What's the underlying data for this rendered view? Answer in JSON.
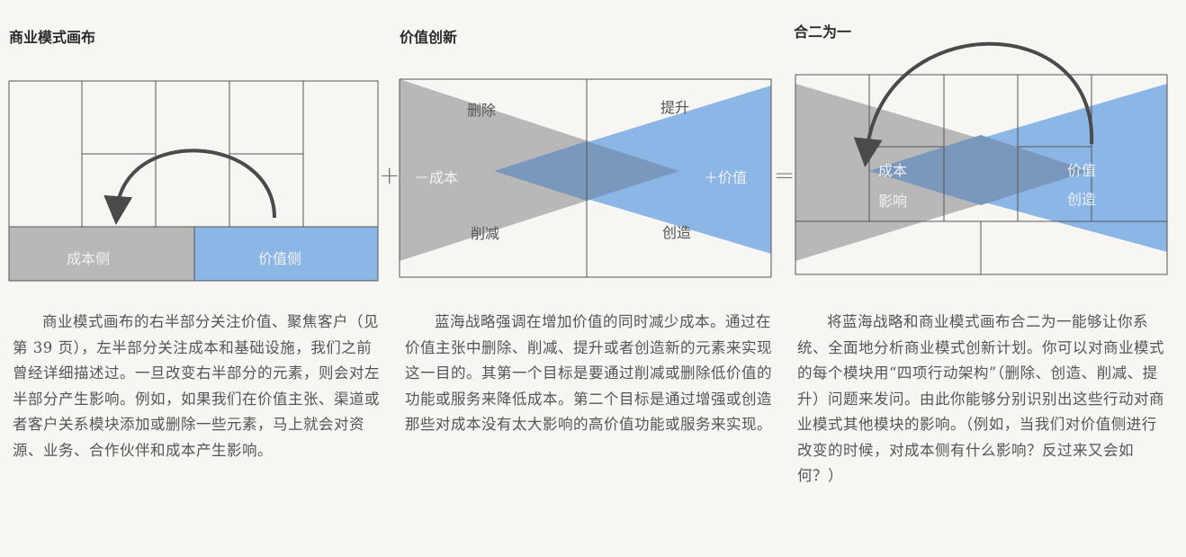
{
  "sections": [
    {
      "title": "商业模式画布",
      "labels": {
        "cost_side": "成本侧",
        "value_side": "价值侧"
      },
      "paragraph": "商业模式画布的右半部分关注价值、聚焦客户（见第 39 页），左半部分关注成本和基础设施，我们之前曾经详细描述过。一旦改变右半部分的元素，则会对左半部分产生影响。例如，如果我们在价值主张、渠道或者客户关系模块添加或删除一些元素，马上就会对资源、业务、合作伙伴和成本产生影响。"
    },
    {
      "title": "价值创新",
      "labels": {
        "eliminate": "删除",
        "raise": "提升",
        "cost": "－成本",
        "value": "＋价值",
        "reduce": "削减",
        "create": "创造"
      },
      "paragraph": "蓝海战略强调在增加价值的同时减少成本。通过在价值主张中删除、削减、提升或者创造新的元素来实现这一目的。其第一个目标是要通过削减或删除低价值的功能或服务来降低成本。第二个目标是通过增强或创造那些对成本没有太大影响的高价值功能或服务来实现。"
    },
    {
      "title": "合二为一",
      "labels": {
        "cost": "成本",
        "impact": "影响",
        "value": "价值",
        "create": "创造"
      },
      "paragraph": "将蓝海战略和商业模式画布合二为一能够让你系统、全面地分析商业模式创新计划。你可以对商业模式的每个模块用“四项行动架构”（删除、创造、削减、提升）问题来发问。由此你能够分别识别出这些行动对商业模式其他模块的影响。（例如，当我们对价值侧进行改变的时候，对成本侧有什么影响？反过来又会如何？）"
    }
  ],
  "operators": {
    "plus": "+",
    "equals": "="
  },
  "colors": {
    "gray": "#b9b8b9",
    "blue": "#8cb6e6",
    "line": "#555555"
  }
}
